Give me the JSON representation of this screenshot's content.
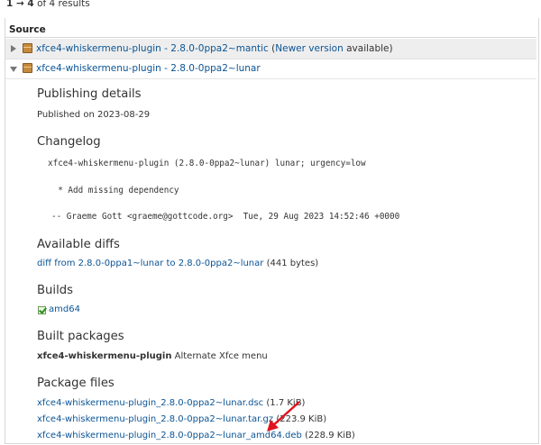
{
  "results": {
    "range": "1 → 4",
    "suffix": "of 4 results"
  },
  "table": {
    "header": "Source"
  },
  "rows": [
    {
      "name": "xfce4-whiskermenu-plugin - 2.8.0-0ppa2~mantic",
      "open_paren": "(",
      "note_link": "Newer version",
      "note_rest": "available)"
    },
    {
      "name": "xfce4-whiskermenu-plugin - 2.8.0-0ppa2~lunar"
    }
  ],
  "publishing": {
    "heading": "Publishing details",
    "text": "Published on 2023-08-29"
  },
  "changelog": {
    "heading": "Changelog",
    "line1": "xfce4-whiskermenu-plugin (2.8.0-0ppa2~lunar) lunar; urgency=low",
    "line2": "  * Add missing dependency",
    "line3": "-- Graeme Gott <graeme@gottcode.org>  Tue, 29 Aug 2023 14:52:46 +0000"
  },
  "diffs": {
    "heading": "Available diffs",
    "link": "diff from 2.8.0-0ppa1~lunar to 2.8.0-0ppa2~lunar",
    "size": "(441 bytes)"
  },
  "builds": {
    "heading": "Builds",
    "arch": "amd64"
  },
  "built_packages": {
    "heading": "Built packages",
    "name": "xfce4-whiskermenu-plugin",
    "desc": "Alternate Xfce menu"
  },
  "package_files": {
    "heading": "Package files",
    "files": [
      {
        "name": "xfce4-whiskermenu-plugin_2.8.0-0ppa2~lunar.dsc",
        "size": "(1.7 KiB)"
      },
      {
        "name": "xfce4-whiskermenu-plugin_2.8.0-0ppa2~lunar.tar.gz",
        "size": "(223.9 KiB)"
      },
      {
        "name": "xfce4-whiskermenu-plugin_2.8.0-0ppa2~lunar_amd64.deb",
        "size": "(228.9 KiB)"
      }
    ]
  },
  "colors": {
    "link": "#0b5494",
    "arrow": "#e0141e",
    "row_bg": "#eeeeee"
  }
}
